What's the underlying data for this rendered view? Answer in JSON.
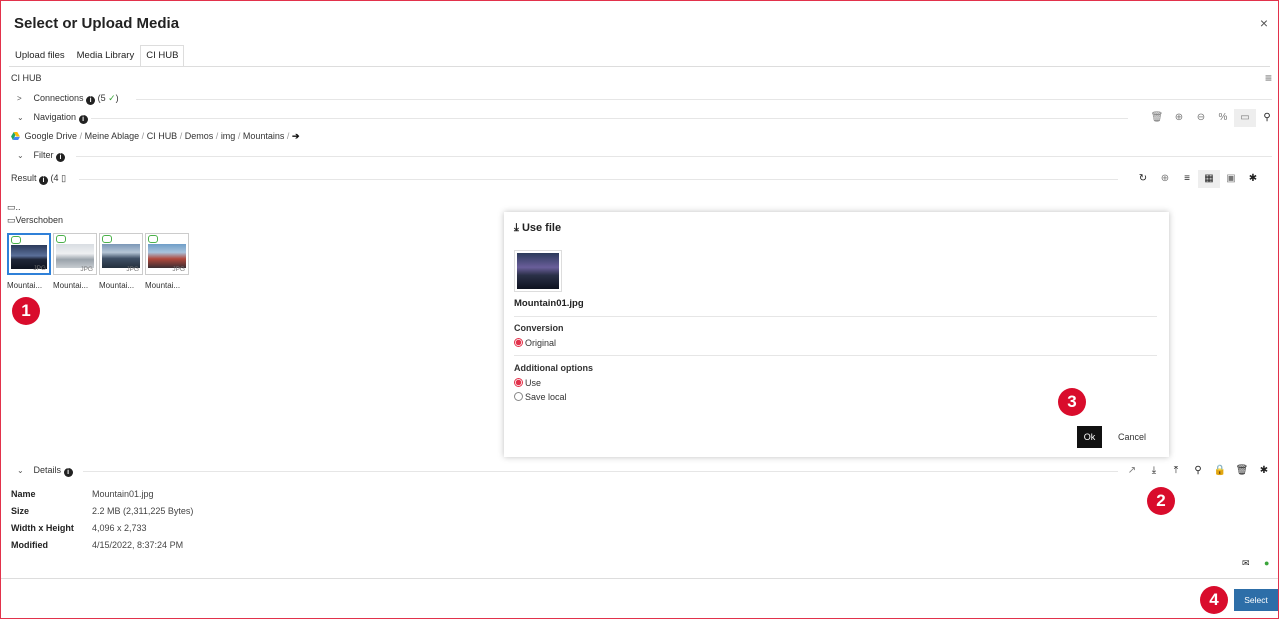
{
  "dialog_title": "Select or Upload Media",
  "close_label": "×",
  "tabs": [
    {
      "label": "Upload files"
    },
    {
      "label": "Media Library"
    },
    {
      "label": "CI HUB"
    }
  ],
  "plugin_label": "CI HUB",
  "menu_icon_glyph": "≡",
  "connections": {
    "label": "Connections",
    "count": "(5",
    "check": "✓",
    "close_paren": ")"
  },
  "navigation": {
    "label": "Navigation"
  },
  "breadcrumb": {
    "items": [
      "Google Drive",
      "Meine Ablage",
      "CI HUB",
      "Demos",
      "img",
      "Mountains"
    ],
    "separator": "/"
  },
  "filter": {
    "label": "Filter"
  },
  "result": {
    "label": "Result",
    "count": "(4"
  },
  "folders": [
    {
      "label": ".."
    },
    {
      "label": "Verschoben"
    }
  ],
  "thumbnails": [
    {
      "label": "Mountai...",
      "ext": "JPG"
    },
    {
      "label": "Mountai...",
      "ext": "JPG"
    },
    {
      "label": "Mountai...",
      "ext": "JPG"
    },
    {
      "label": "Mountai...",
      "ext": "JPG"
    }
  ],
  "badges": [
    "1",
    "2",
    "3",
    "4"
  ],
  "use_file": {
    "title": "Use file",
    "filename": "Mountain01.jpg",
    "conversion_label": "Conversion",
    "conversion_option": "Original",
    "additional_label": "Additional options",
    "option_use": "Use",
    "option_save_local": "Save local",
    "ok_label": "Ok",
    "cancel_label": "Cancel"
  },
  "details": {
    "label": "Details",
    "rows": [
      {
        "key": "Name",
        "value": "Mountain01.jpg"
      },
      {
        "key": "Size",
        "value": "2.2 MB (2,311,225 Bytes)"
      },
      {
        "key": "Width x Height",
        "value": "4,096 x 2,733"
      },
      {
        "key": "Modified",
        "value": "4/15/2022, 8:37:24 PM"
      }
    ]
  },
  "select_label": "Select",
  "colors": {
    "accent": "#e2324b",
    "select_button": "#2d6ea8",
    "badge": "#d90c2c",
    "selection": "#2f80d8"
  }
}
